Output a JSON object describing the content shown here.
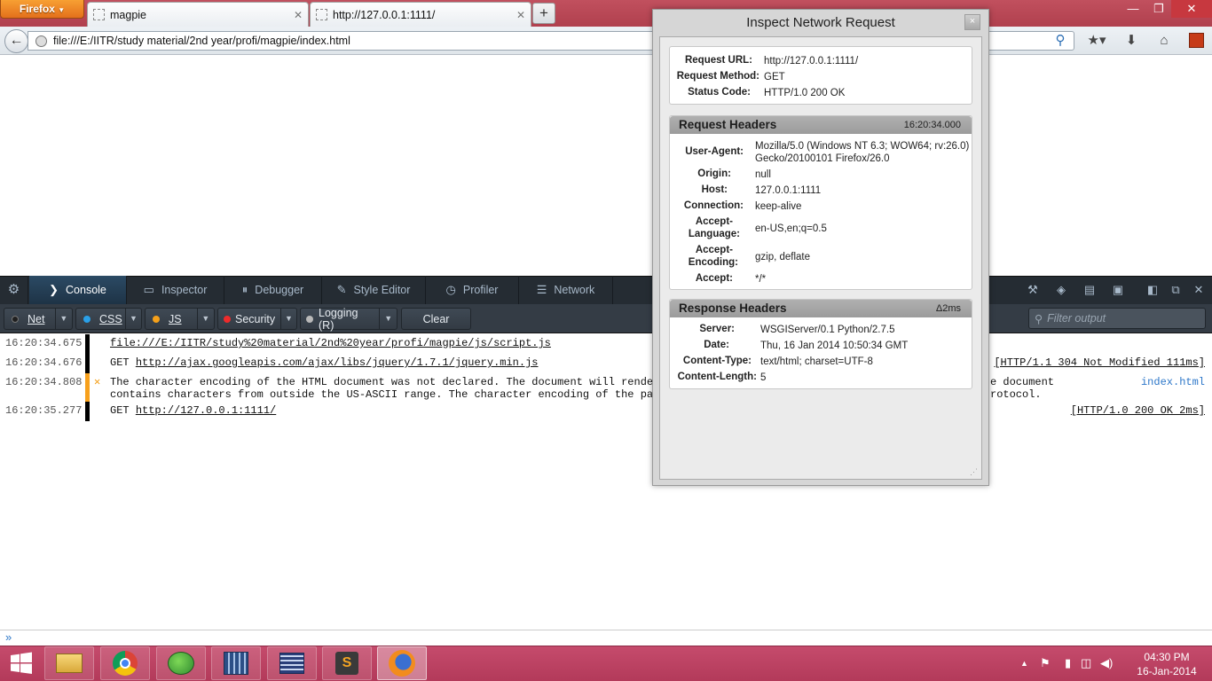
{
  "browser": {
    "app_button": "Firefox",
    "tabs": [
      {
        "label": "magpie"
      },
      {
        "label": "http://127.0.0.1:1111/"
      }
    ],
    "new_tab": "+",
    "url": "file:///E:/IITR/study material/2nd year/profi/magpie/index.html"
  },
  "devtools": {
    "tabs": [
      "Console",
      "Inspector",
      "Debugger",
      "Style Editor",
      "Profiler",
      "Network"
    ],
    "filters": {
      "net": "Net",
      "css": "CSS",
      "js": "JS",
      "security": "Security",
      "logging": "Logging (R)",
      "clear": "Clear",
      "filter_placeholder": "Filter output"
    },
    "colors": {
      "net_dot": "#1f1f1f",
      "css_dot": "#2aa0e8",
      "js_dot": "#f5a01a",
      "security_dot": "#ee2b2b",
      "logging_dot": "#b9b9b9",
      "warning_bar": "#f7a01c"
    },
    "console": [
      {
        "time": "16:20:34.675",
        "text": "file:///E:/IITR/study%20material/2nd%20year/profi/magpie/js/script.js",
        "right": ""
      },
      {
        "time": "16:20:34.676",
        "method": "GET",
        "text": "http://ajax.googleapis.com/ajax/libs/jquery/1.7.1/jquery.min.js",
        "right": "[HTTP/1.1 304 Not Modified 111ms]"
      },
      {
        "time": "16:20:34.808",
        "line1": "The character encoding of the HTML document was not declared. The document will render w",
        "line1_tail": "e document",
        "line2": "contains characters from outside the US-ASCII range. The character encoding of the page",
        "line2_tail": "rotocol.",
        "right": "index.html"
      },
      {
        "time": "16:20:35.277",
        "method": "GET",
        "text": "http://127.0.0.1:1111/",
        "right": "[HTTP/1.0 200 OK 2ms]"
      }
    ]
  },
  "dialog": {
    "title": "Inspect Network Request",
    "close": "×",
    "summary": [
      {
        "key": "Request URL:",
        "value": "http://127.0.0.1:1111/"
      },
      {
        "key": "Request Method:",
        "value": "GET"
      },
      {
        "key": "Status Code:",
        "value": "HTTP/1.0 200 OK"
      }
    ],
    "request_headers": {
      "title": "Request Headers",
      "time": "16:20:34.000",
      "items": [
        {
          "key": "User-Agent:",
          "value": "Mozilla/5.0 (Windows NT 6.3; WOW64; rv:26.0)",
          "value2": "Gecko/20100101 Firefox/26.0"
        },
        {
          "key": "Origin:",
          "value": "null"
        },
        {
          "key": "Host:",
          "value": "127.0.0.1:1111"
        },
        {
          "key": "Connection:",
          "value": "keep-alive"
        },
        {
          "key": "Accept-",
          "key2": "Language:",
          "value": "en-US,en;q=0.5"
        },
        {
          "key": "Accept-",
          "key2": "Encoding:",
          "value": "gzip, deflate"
        },
        {
          "key": "Accept:",
          "value": "*/*"
        }
      ]
    },
    "response_headers": {
      "title": "Response Headers",
      "time": "Δ2ms",
      "items": [
        {
          "key": "Server:",
          "value": "WSGIServer/0.1 Python/2.7.5"
        },
        {
          "key": "Date:",
          "value": "Thu, 16 Jan 2014 10:50:34 GMT"
        },
        {
          "key": "Content-Type:",
          "value": "text/html; charset=UTF-8"
        },
        {
          "key": "Content-Length:",
          "value": "5"
        }
      ]
    }
  },
  "taskbar": {
    "time": "04:30 PM",
    "date": "16-Jan-2014"
  }
}
